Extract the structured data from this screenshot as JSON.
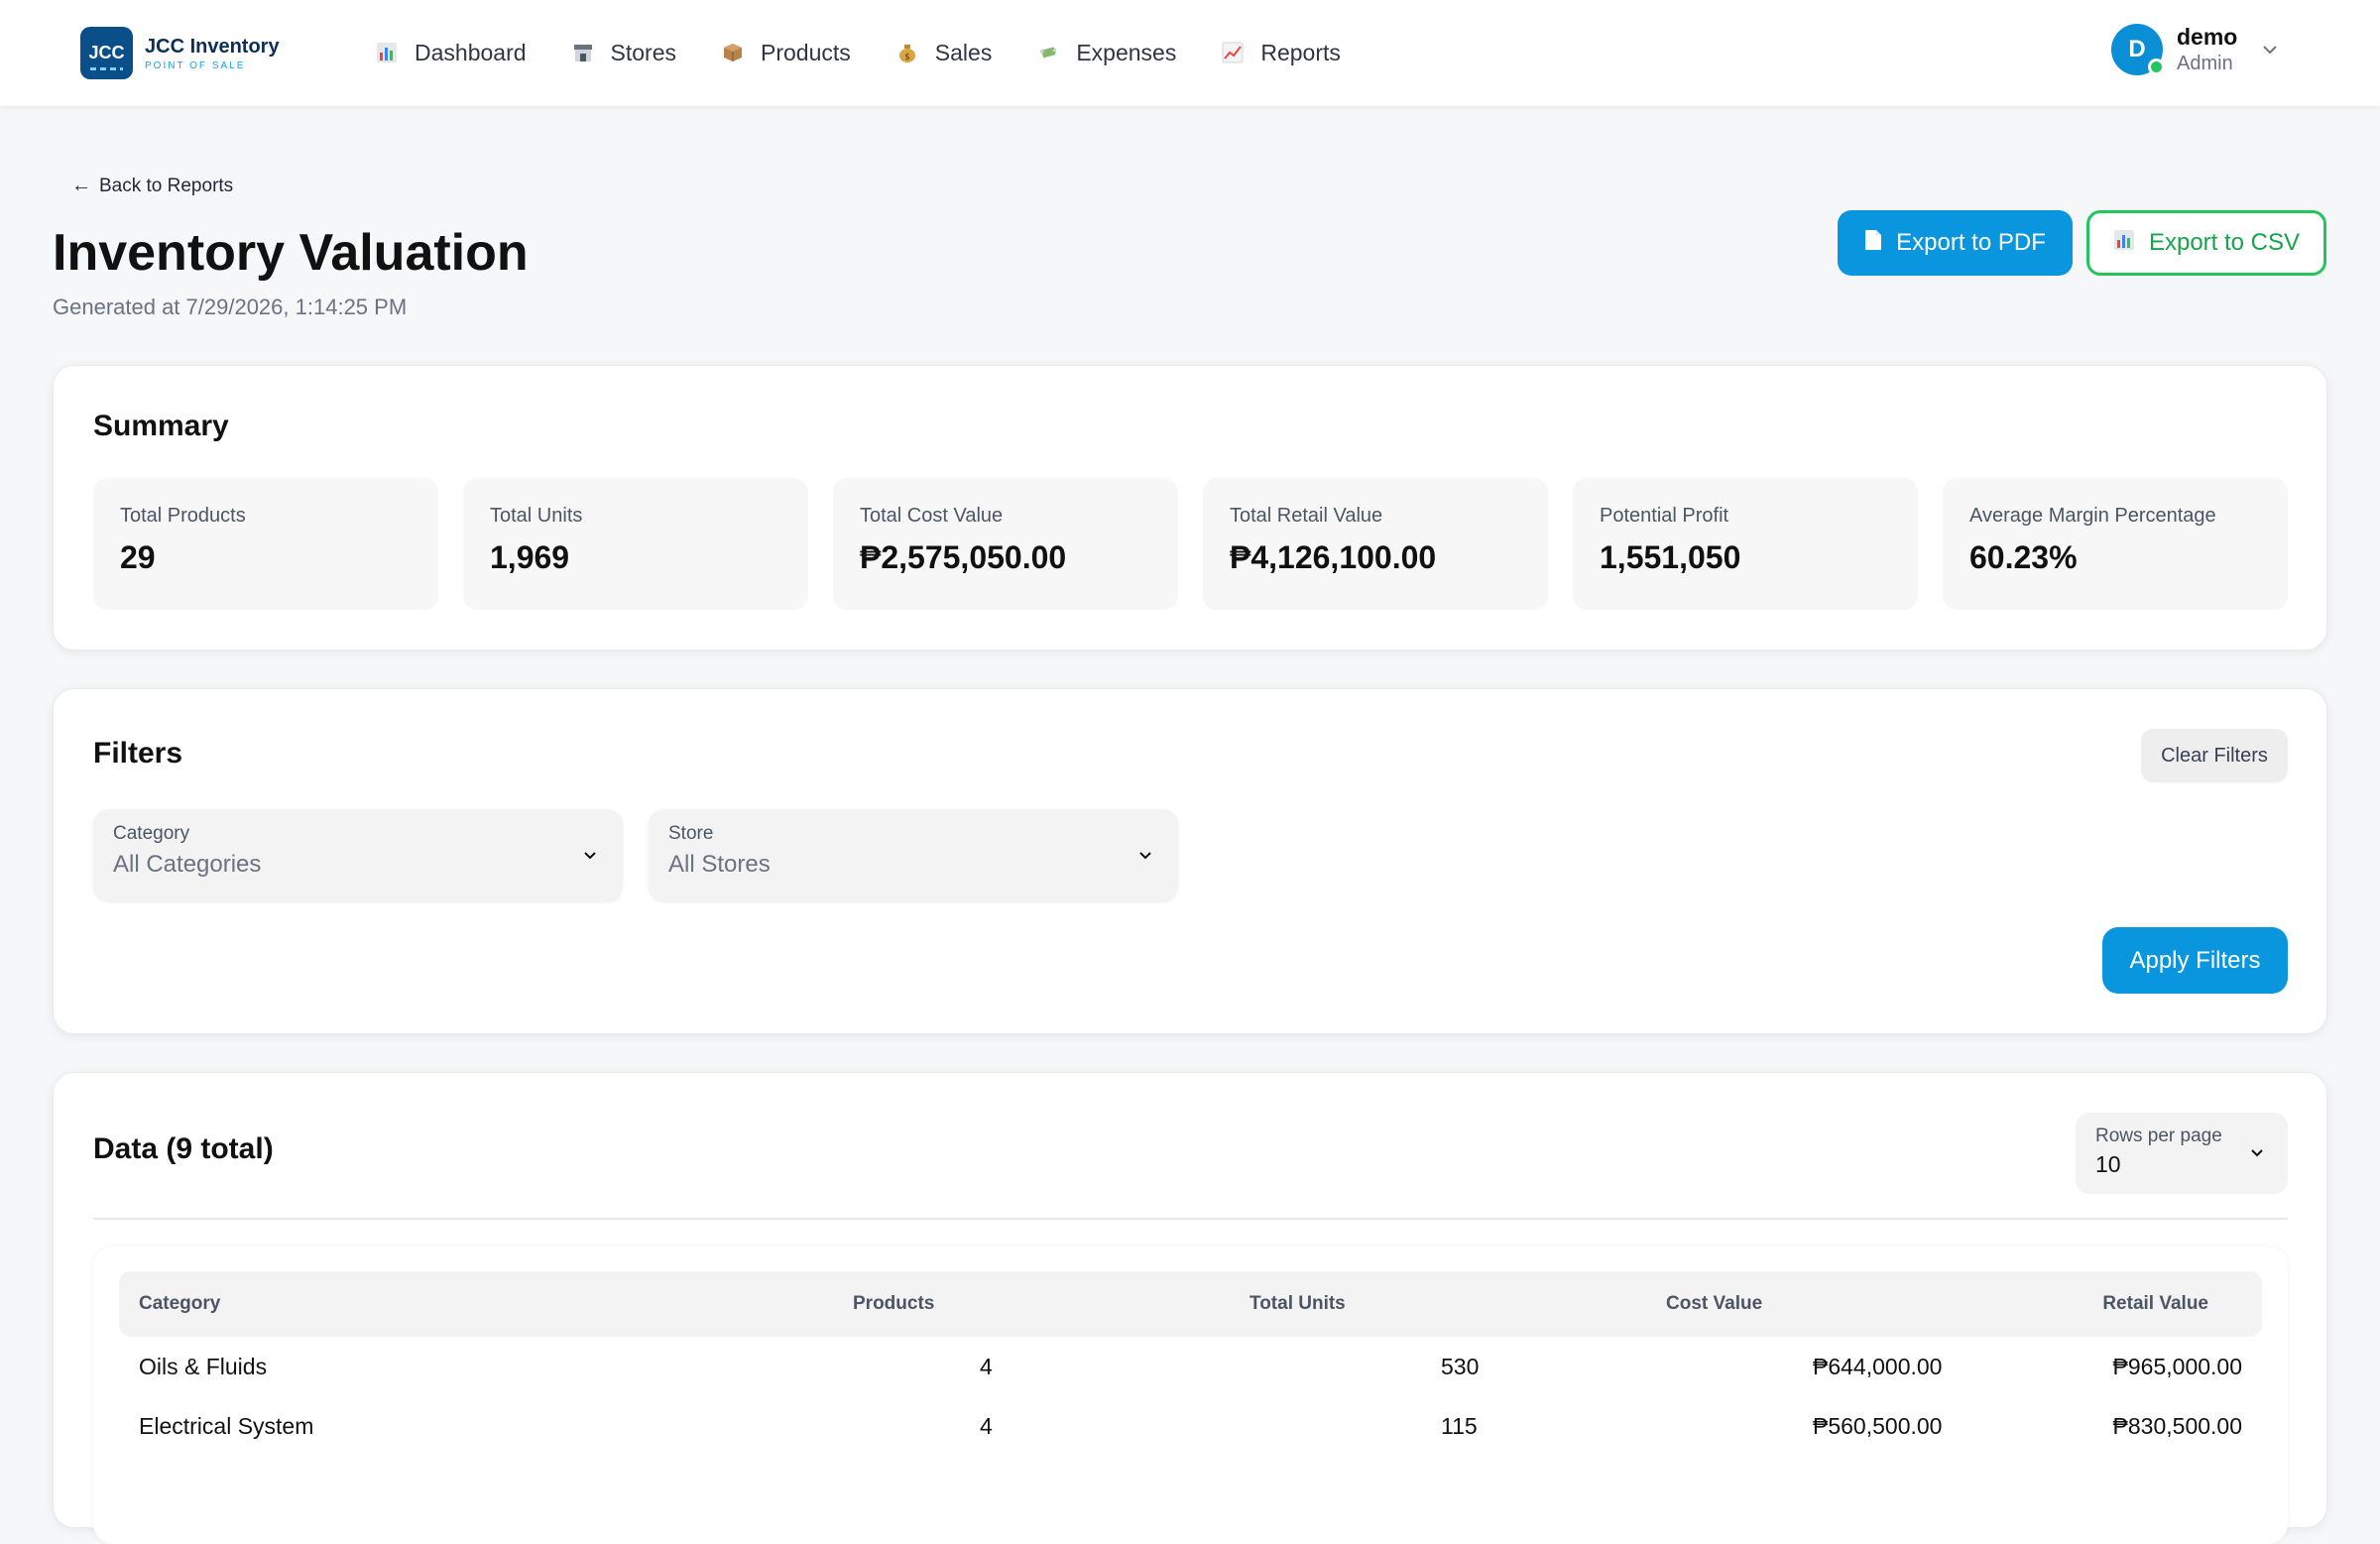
{
  "app": {
    "logo_mark": "JCC",
    "name": "JCC Inventory",
    "tagline": "POINT OF SALE"
  },
  "nav": [
    {
      "label": "Dashboard",
      "icon": "bar-chart-icon"
    },
    {
      "label": "Stores",
      "icon": "store-icon"
    },
    {
      "label": "Products",
      "icon": "box-icon"
    },
    {
      "label": "Sales",
      "icon": "money-bag-icon"
    },
    {
      "label": "Expenses",
      "icon": "money-wings-icon"
    },
    {
      "label": "Reports",
      "icon": "trend-chart-icon"
    }
  ],
  "user": {
    "initial": "D",
    "name": "demo",
    "role": "Admin"
  },
  "page": {
    "back_label": "Back to Reports",
    "title": "Inventory Valuation",
    "generated": "Generated at 7/29/2026, 1:14:25 PM",
    "export_pdf": "Export to PDF",
    "export_csv": "Export to CSV"
  },
  "summary": {
    "title": "Summary",
    "stats": [
      {
        "label": "Total Products",
        "value": "29"
      },
      {
        "label": "Total Units",
        "value": "1,969"
      },
      {
        "label": "Total Cost Value",
        "value": "₱2,575,050.00"
      },
      {
        "label": "Total Retail Value",
        "value": "₱4,126,100.00"
      },
      {
        "label": "Potential Profit",
        "value": "1,551,050"
      },
      {
        "label": "Average Margin Percentage",
        "value": "60.23%"
      }
    ]
  },
  "filters": {
    "title": "Filters",
    "clear_label": "Clear Filters",
    "apply_label": "Apply Filters",
    "category": {
      "label": "Category",
      "value": "All Categories"
    },
    "store": {
      "label": "Store",
      "value": "All Stores"
    }
  },
  "data": {
    "title": "Data (9 total)",
    "rows_per_page_label": "Rows per page",
    "rows_per_page_value": "10",
    "columns": [
      "Category",
      "Products",
      "Total Units",
      "Cost Value",
      "Retail Value"
    ],
    "rows": [
      [
        "Oils & Fluids",
        "4",
        "530",
        "₱644,000.00",
        "₱965,000.00"
      ],
      [
        "Electrical System",
        "4",
        "115",
        "₱560,500.00",
        "₱830,500.00"
      ]
    ]
  },
  "colors": {
    "primary": "#0a96de",
    "success": "#22c55e",
    "brand_dark": "#0b4f8a"
  }
}
